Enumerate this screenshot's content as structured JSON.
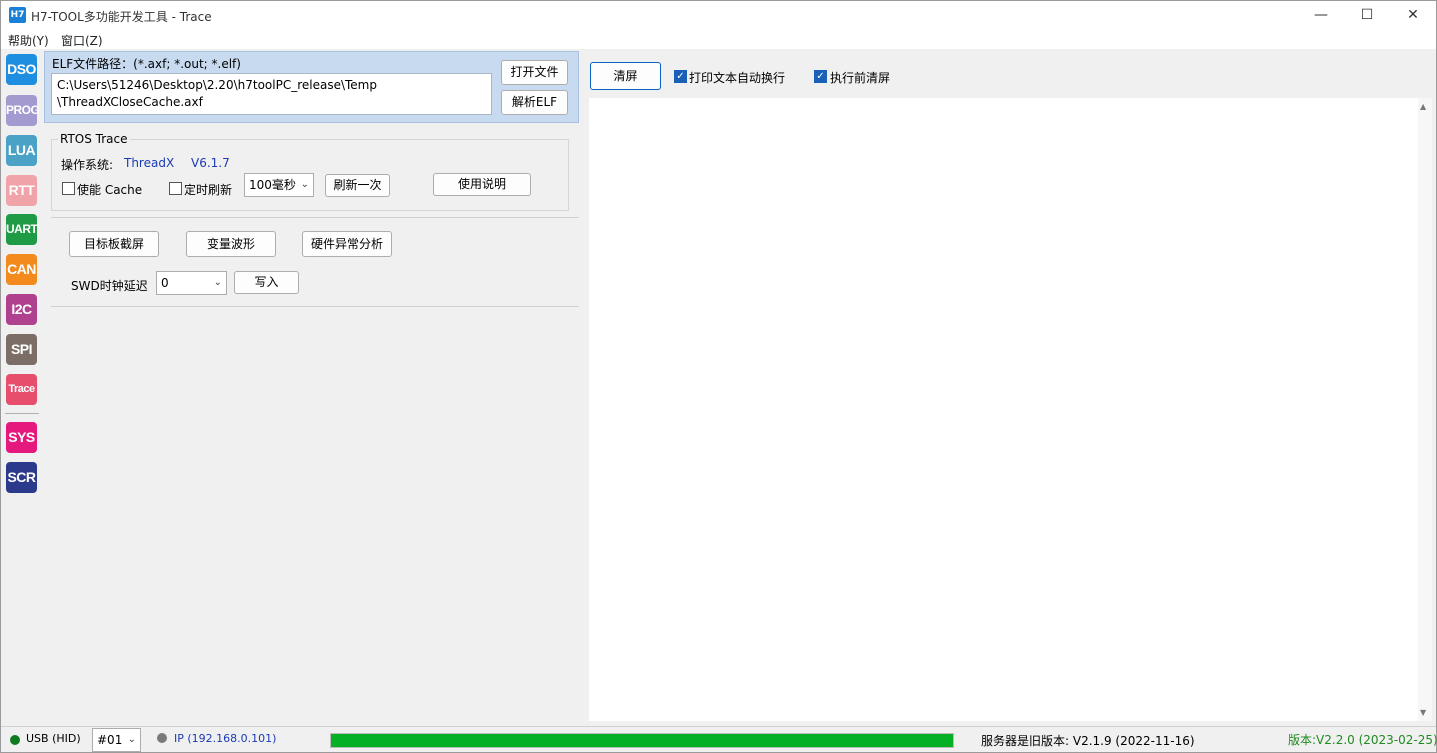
{
  "window": {
    "app_icon": "H7",
    "title": "H7-TOOL多功能开发工具 - Trace",
    "minimize": "—",
    "maximize": "☐",
    "close": "✕"
  },
  "menu": [
    "帮助(Y)",
    "窗口(Z)"
  ],
  "sidebar": [
    {
      "label": "DSO",
      "color": "#1e8fe0"
    },
    {
      "label": "PROG",
      "color": "#a39bd0"
    },
    {
      "label": "LUA",
      "color": "#4aa3c7"
    },
    {
      "label": "RTT",
      "color": "#f0a3a8"
    },
    {
      "label": "UART",
      "color": "#1f9a45"
    },
    {
      "label": "CAN",
      "color": "#f28a1e"
    },
    {
      "label": "I2C",
      "color": "#b0418e"
    },
    {
      "label": "SPI",
      "color": "#7c6e66"
    },
    {
      "label": "Trace",
      "color": "#e64e6c"
    },
    {
      "label": "SYS",
      "color": "#e5187e"
    },
    {
      "label": "SCR",
      "color": "#2c3a8c"
    }
  ],
  "elf": {
    "label": "ELF文件路径：(*.axf; *.out; *.elf)",
    "path": "C:\\Users\\51246\\Desktop\\2.20\\h7toolPC_release\\Temp\n\\ThreadXCloseCache.axf",
    "open_button": "打开文件",
    "parse_button": "解析ELF"
  },
  "rtos": {
    "group_title": "RTOS Trace",
    "os_label": "操作系统:",
    "os_name": "ThreadX",
    "os_version": "V6.1.7",
    "cache_label": "使能 Cache",
    "cache_checked": false,
    "timer_label": "定时刷新",
    "timer_checked": false,
    "interval_value": "100毫秒",
    "refresh_once": "刷新一次",
    "help_button": "使用说明"
  },
  "tools": {
    "screenshot_button": "目标板截屏",
    "waveform_button": "变量波形",
    "hardfault_button": "硬件异常分析",
    "swd_label": "SWD时钟延迟",
    "swd_value": "0",
    "write_button": "写入"
  },
  "output": {
    "clear_button": "清屏",
    "autowrap_label": "打印文本自动换行",
    "autowrap_checked": true,
    "clear_before_label": "执行前清屏",
    "clear_before_checked": true
  },
  "status": {
    "usb_label": "USB (HID)",
    "usb_color": "#0f7a1f",
    "device_value": "#01",
    "ip_label": "IP (192.168.0.101)",
    "ip_color": "#7a7a7a",
    "progress_percent": 100,
    "server_version": "服务器是旧版本: V2.1.9 (2022-11-16)",
    "local_version": "版本:V2.2.0 (2023-02-25)"
  }
}
